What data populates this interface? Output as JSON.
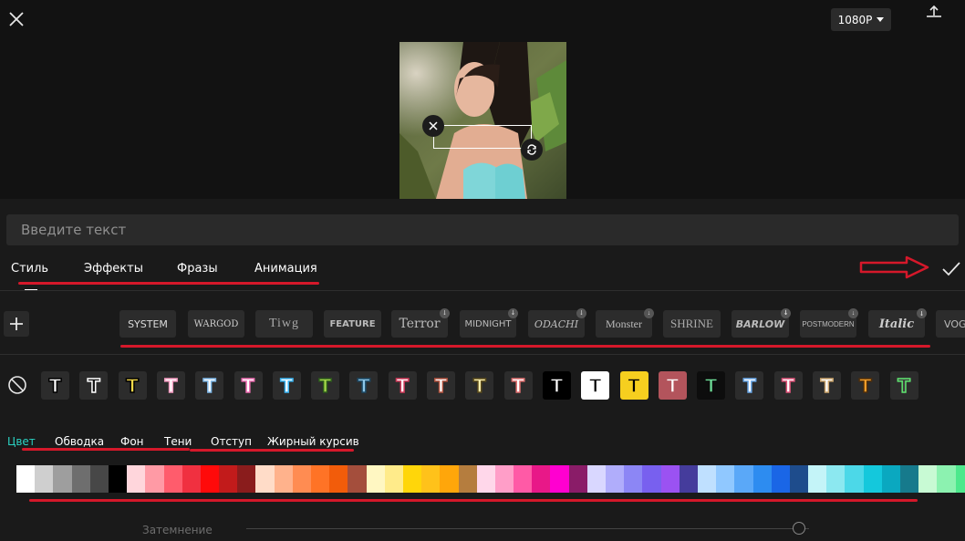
{
  "header": {
    "resolution_label": "1080P",
    "icons": [
      "close-icon",
      "chevron-down-icon",
      "export-icon"
    ]
  },
  "text_input": {
    "placeholder": "Введите текст",
    "value": ""
  },
  "tabs": [
    {
      "label": "Стиль",
      "active": true
    },
    {
      "label": "Эффекты",
      "active": false
    },
    {
      "label": "Фразы",
      "active": false
    },
    {
      "label": "Анимация",
      "active": false
    }
  ],
  "fonts": [
    {
      "label": "SYSTEM",
      "download": false
    },
    {
      "label": "WARGOD",
      "download": false
    },
    {
      "label": "Tiwg",
      "download": false
    },
    {
      "label": "FEATURE",
      "download": false
    },
    {
      "label": "Terror",
      "download": true
    },
    {
      "label": "MIDNIGHT",
      "download": true
    },
    {
      "label": "ODACHI",
      "download": true
    },
    {
      "label": "Monster",
      "download": true
    },
    {
      "label": "SHRINE",
      "download": false
    },
    {
      "label": "BARLOW",
      "download": true
    },
    {
      "label": "POSTMODERN",
      "download": true
    },
    {
      "label": "Italic",
      "download": true
    },
    {
      "label": "VOG",
      "download": false
    }
  ],
  "text_styles": [
    {
      "glyph": "T",
      "bg": "#2c2c2c",
      "fg": "#ffffff",
      "stroke": "#000000"
    },
    {
      "glyph": "T",
      "bg": "#2c2c2c",
      "fg": "#111111",
      "stroke": "#ffffff"
    },
    {
      "glyph": "T",
      "bg": "#2c2c2c",
      "fg": "#f5d94a",
      "stroke": "#000000"
    },
    {
      "glyph": "T",
      "bg": "#2c2c2c",
      "fg": "#ffffff",
      "stroke": "#f39bc0"
    },
    {
      "glyph": "T",
      "bg": "#2c2c2c",
      "fg": "#ffffff",
      "stroke": "#7fb8e8"
    },
    {
      "glyph": "T",
      "bg": "#2c2c2c",
      "fg": "#ffffff",
      "stroke": "#ef6fb4"
    },
    {
      "glyph": "T",
      "bg": "#2c2c2c",
      "fg": "#ffffff",
      "stroke": "#3ab3f0"
    },
    {
      "glyph": "T",
      "bg": "#2c2c2c",
      "fg": "#a6d94a",
      "stroke": "#2d5a1d"
    },
    {
      "glyph": "T",
      "bg": "#2c2c2c",
      "fg": "#8ec7e8",
      "stroke": "#1d4a66"
    },
    {
      "glyph": "T",
      "bg": "#2c2c2c",
      "fg": "#ffffff",
      "stroke": "#d23a5a"
    },
    {
      "glyph": "T",
      "bg": "#2c2c2c",
      "fg": "#ffffff",
      "stroke": "#b2533f"
    },
    {
      "glyph": "T",
      "bg": "#2c2c2c",
      "fg": "#fff2b0",
      "stroke": "#5a4b1c"
    },
    {
      "glyph": "T",
      "bg": "#2c2c2c",
      "fg": "#ffffff",
      "stroke": "#e07070"
    },
    {
      "glyph": "T",
      "bg": "#000000",
      "fg": "#ffffff",
      "stroke": "#000000"
    },
    {
      "glyph": "T",
      "bg": "#ffffff",
      "fg": "#000000",
      "stroke": "#ffffff"
    },
    {
      "glyph": "T",
      "bg": "#f6cf1f",
      "fg": "#000000",
      "stroke": "#f6cf1f"
    },
    {
      "glyph": "T",
      "bg": "#b3545c",
      "fg": "#ffffff",
      "stroke": "#b3545c"
    },
    {
      "glyph": "T",
      "bg": "#0d0d0d",
      "fg": "#6fe09a",
      "stroke": "#0d0d0d"
    },
    {
      "glyph": "T",
      "bg": "#2c2c2c",
      "fg": "#ffffff",
      "stroke": "#6aa8e8"
    },
    {
      "glyph": "T",
      "bg": "#2c2c2c",
      "fg": "#ffffff",
      "stroke": "#e0547a"
    },
    {
      "glyph": "T",
      "bg": "#2c2c2c",
      "fg": "#ffffff",
      "stroke": "#c9a36b"
    },
    {
      "glyph": "T",
      "bg": "#2c2c2c",
      "fg": "#f59f2a",
      "stroke": "#4d2e0c"
    },
    {
      "glyph": "T",
      "bg": "#2c2c2c",
      "fg": "#3e3e3e",
      "stroke": "#5fe36f"
    }
  ],
  "subtabs": [
    {
      "label": "Цвет",
      "active": true
    },
    {
      "label": "Обводка",
      "active": false
    },
    {
      "label": "Фон",
      "active": false
    },
    {
      "label": "Тени",
      "active": false
    },
    {
      "label": "Отступ",
      "active": false
    },
    {
      "label": "Жирный курсив",
      "active": false
    }
  ],
  "palette": [
    "#ffffff",
    "#cfcfcf",
    "#9e9e9e",
    "#6e6e6e",
    "#474747",
    "#000000",
    "#ffd6dc",
    "#ff9aa5",
    "#ff5c6c",
    "#f03040",
    "#ff0a0a",
    "#c21b1b",
    "#8a1c1c",
    "#ffdcc8",
    "#ffb28c",
    "#ff8c52",
    "#ff7326",
    "#f25c0a",
    "#a44e3c",
    "#fff7c2",
    "#ffeb8a",
    "#ffd60a",
    "#ffc21a",
    "#ffa60a",
    "#b57d3e",
    "#ffd7ea",
    "#ff9ec8",
    "#ff5aa6",
    "#e81888",
    "#ff00d0",
    "#8a1c68",
    "#d9d7ff",
    "#b0adfb",
    "#8c86f5",
    "#7860ef",
    "#9b52f2",
    "#453c9c",
    "#bfe0ff",
    "#90c8ff",
    "#5aa8f8",
    "#2d8cf0",
    "#1a66e6",
    "#1e4c8c",
    "#c4f4f8",
    "#8ce8f0",
    "#4cd8e8",
    "#14c8dc",
    "#0aa8c0",
    "#167a8c",
    "#c8fad4",
    "#8cf2b0",
    "#4ce88c",
    "#14d070"
  ],
  "opacity": {
    "label": "Затемнение",
    "value": 0.98
  },
  "accent_color": "#2bd3c3",
  "annotation_color": "#d5182a"
}
